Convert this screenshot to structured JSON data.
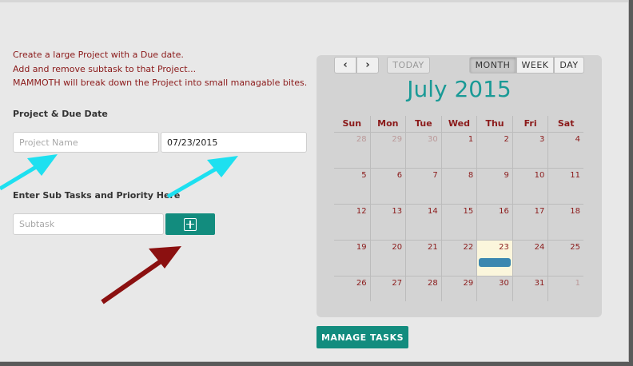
{
  "intro": {
    "line1": "Create a large Project with a Due date.",
    "line2": "Add and remove subtask to that Project...",
    "line3": "MAMMOTH will break down the Project into small managable bites."
  },
  "project": {
    "section_label": "Project & Due Date",
    "name_placeholder": "Project Name",
    "due_date_value": "07/23/2015"
  },
  "subtask": {
    "section_label": "Enter Sub Tasks and Priority Here",
    "placeholder": "Subtask",
    "add_icon": "plus-square-icon"
  },
  "calendar": {
    "prev_label": "‹",
    "next_label": "›",
    "today_label": "TODAY",
    "views": [
      "MONTH",
      "WEEK",
      "DAY"
    ],
    "active_view": "MONTH",
    "title": "July 2015",
    "weekdays": [
      "Sun",
      "Mon",
      "Tue",
      "Wed",
      "Thu",
      "Fri",
      "Sat"
    ],
    "weeks": [
      [
        "28",
        "29",
        "30",
        "1",
        "2",
        "3",
        "4"
      ],
      [
        "5",
        "6",
        "7",
        "8",
        "9",
        "10",
        "11"
      ],
      [
        "12",
        "13",
        "14",
        "15",
        "16",
        "17",
        "18"
      ],
      [
        "19",
        "20",
        "21",
        "22",
        "23",
        "24",
        "25"
      ],
      [
        "26",
        "27",
        "28",
        "29",
        "30",
        "31",
        "1"
      ]
    ],
    "today_date": "23",
    "event_color": "#3b87b0"
  },
  "manage_button": "MANAGE TASKS",
  "colors": {
    "accent": "#128c7e",
    "title": "#1a9a96",
    "text_red": "#8b1a1a",
    "cyan_arrow": "#1de0f0",
    "red_arrow": "#8b1010"
  }
}
